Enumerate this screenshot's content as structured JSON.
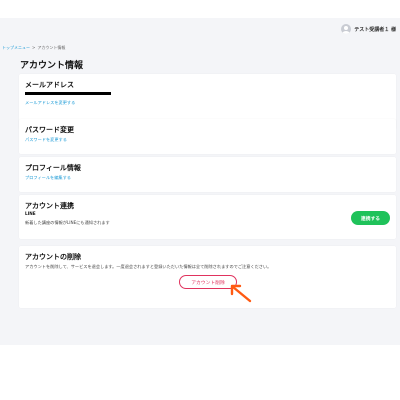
{
  "header": {
    "user_name": "テスト受講者１ 様"
  },
  "breadcrumb": {
    "items": [
      "トップメニュー",
      "アカウント情報"
    ],
    "separator": ">"
  },
  "page": {
    "title": "アカウント情報"
  },
  "email_card": {
    "title": "メールアドレス",
    "link": "メールアドレスを変更する"
  },
  "password_card": {
    "title": "パスワード変更",
    "link": "パスワードを変更する"
  },
  "profile_card": {
    "title": "プロフィール情報",
    "link": "プロフィールを編集する"
  },
  "link_card": {
    "title": "アカウント連携",
    "service": "LINE",
    "description": "新着した講座の情報がLINEにも通知されます",
    "button": "連携する"
  },
  "delete_card": {
    "title": "アカウントの削除",
    "description": "アカウントを削除して、サービスを退会します。一度退会されますと登録いただいた情報は全て削除されますのでご注意ください。",
    "button": "アカウント削除"
  },
  "colors": {
    "link": "#1a9ad6",
    "connect_button": "#1fc25a",
    "delete_accent": "#e0335e",
    "annotation_arrow": "#ff5a12",
    "page_background": "#f4f5f8"
  }
}
